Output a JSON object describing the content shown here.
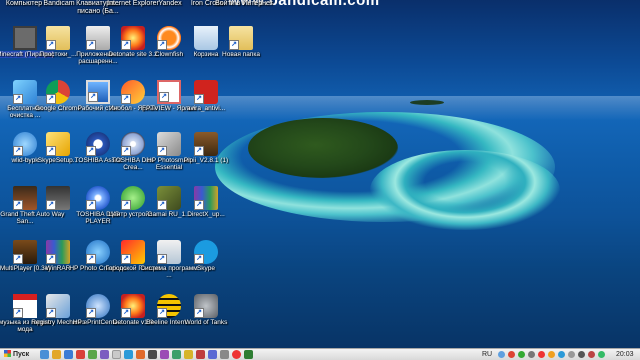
{
  "watermark": "www.bandicam.com",
  "top_labels": [
    "Компьютер",
    "Bandicam",
    "Клавиатура... писано (Ба...",
    "Internet Explorer",
    "Yandex",
    "Iron Cross",
    "Войти в Интернет"
  ],
  "icons": [
    {
      "name": "Minecraft (Пиратка)",
      "icon": "minecraft-icon",
      "selected": true
    },
    {
      "name": "Простоки_...",
      "icon": "folder-icon"
    },
    {
      "name": "Приложение... расшаренн...",
      "icon": "printer-icon"
    },
    {
      "name": "Detonate site 3.2",
      "icon": "detonate-icon"
    },
    {
      "name": "Clownfish",
      "icon": "clownfish-icon"
    },
    {
      "name": "Корзина",
      "icon": "recycle-bin-icon"
    },
    {
      "name": "Новая папка",
      "icon": "folder-icon"
    },
    {
      "name": "Бесплатная очистка ...",
      "icon": "cleaner-icon"
    },
    {
      "name": "Google Chrome",
      "icon": "chrome-icon"
    },
    {
      "name": "Рабочий стол",
      "icon": "monitor-icon"
    },
    {
      "name": "Инобол - Ярлык",
      "icon": "paint-icon"
    },
    {
      "name": "FPTVIEW - Ярлык",
      "icon": "fptview-icon"
    },
    {
      "name": "avira_antivi...",
      "icon": "avira-icon"
    },
    {
      "name": "wlid-bypk",
      "icon": "globe-icon"
    },
    {
      "name": "SkypeSetup...",
      "icon": "skype-setup-icon"
    },
    {
      "name": "TOSHIBA Assist",
      "icon": "toshiba-icon"
    },
    {
      "name": "TOSHIBA Disc Crea...",
      "icon": "disc-icon"
    },
    {
      "name": "HP Photosmart Essential",
      "icon": "hp-photo-icon"
    },
    {
      "name": "Pipii_V2.8.1 (1)",
      "icon": "pipii-icon"
    },
    {
      "name": "Grand Theft Auto San...",
      "icon": "gta-icon"
    },
    {
      "name": "Way",
      "icon": "way-icon"
    },
    {
      "name": "TOSHIBA DVD PLAYER",
      "icon": "dvd-player-icon"
    },
    {
      "name": "Центр устройс...",
      "icon": "devices-icon"
    },
    {
      "name": "Gamai RU_1...",
      "icon": "game-icon"
    },
    {
      "name": "DirectX_up...",
      "icon": "winrar-icon"
    },
    {
      "name": "MultiPlayer [0.3e]",
      "icon": "multiplayer-icon"
    },
    {
      "name": "WinRAR",
      "icon": "winrar-icon"
    },
    {
      "name": "HP Photo Creations",
      "icon": "hp-creations-icon"
    },
    {
      "name": "Городской Гонщик",
      "icon": "racer-icon"
    },
    {
      "name": "Система программ ...",
      "icon": "system-icon"
    },
    {
      "name": "Skype",
      "icon": "skype-icon"
    },
    {
      "name": "музыка из гаррис мода",
      "icon": "pdf-icon"
    },
    {
      "name": "Registry Mechanic",
      "icon": "registry-icon"
    },
    {
      "name": "HP ePrintCente...",
      "icon": "hp-eprint-icon"
    },
    {
      "name": "Detonate v1.0",
      "icon": "detonate-icon"
    },
    {
      "name": "Beeline Intern...",
      "icon": "beeline-icon"
    },
    {
      "name": "World of Tanks",
      "icon": "tanks-icon"
    }
  ],
  "taskbar": {
    "start_label": "Пуск",
    "language": "RU",
    "clock": "20:03"
  }
}
